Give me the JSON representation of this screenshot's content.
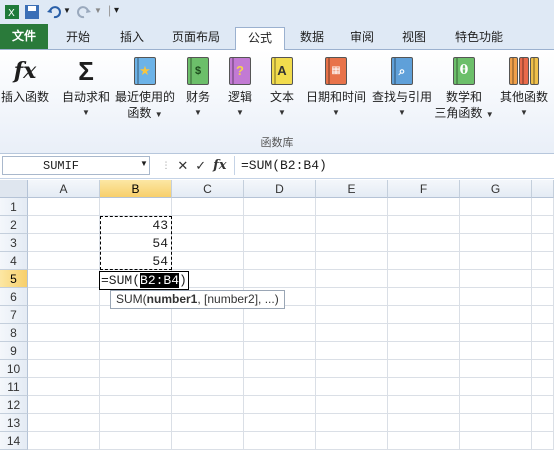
{
  "ribbon_tabs": [
    {
      "label": "文件"
    },
    {
      "label": "开始"
    },
    {
      "label": "插入"
    },
    {
      "label": "页面布局"
    },
    {
      "label": "公式"
    },
    {
      "label": "数据"
    },
    {
      "label": "审阅"
    },
    {
      "label": "视图"
    },
    {
      "label": "特色功能"
    }
  ],
  "ribbon_buttons": {
    "insert_function": "插入函数",
    "autosum_line1": "自动求和",
    "recent_line1": "最近使用的",
    "recent_line2": "函数",
    "financial": "财务",
    "logical": "逻辑",
    "text": "文本",
    "datetime": "日期和时间",
    "lookup": "查找与引用",
    "math_line1": "数学和",
    "math_line2": "三角函数",
    "more": "其他函数",
    "group_label": "函数库"
  },
  "formula_bar": {
    "name_box": "SUMIF",
    "formula": "=SUM(B2:B4)"
  },
  "columns": [
    "A",
    "B",
    "C",
    "D",
    "E",
    "F",
    "G"
  ],
  "rows": [
    "1",
    "2",
    "3",
    "4",
    "5",
    "6",
    "7",
    "8",
    "9",
    "10",
    "11",
    "12",
    "13",
    "14"
  ],
  "cells": {
    "b2": "43",
    "b3": "54",
    "b4": "54",
    "b5_prefix": "=SUM(",
    "b5_range": "B2:B4",
    "b5_suffix": ")"
  },
  "tooltip": {
    "fn": "SUM(",
    "arg1": "number1",
    "rest": ", [number2], ...)"
  },
  "colors": {
    "file_tab": "#2a7a3a",
    "selected_header": "#f7cf6b"
  }
}
